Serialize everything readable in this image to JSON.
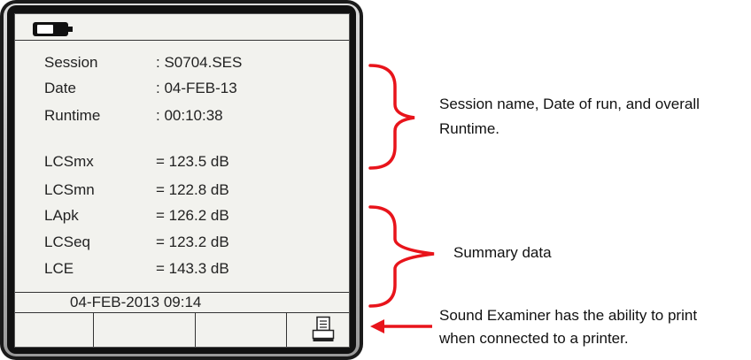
{
  "screen": {
    "status_bar": {
      "battery_icon": "battery-icon"
    },
    "rows": [
      {
        "label": "Session",
        "value": ": S0704.SES"
      },
      {
        "label": "Date",
        "value": ": 04-FEB-13"
      },
      {
        "label": "Runtime",
        "value": ": 00:10:38"
      },
      {
        "label": "LCSmx",
        "value": "= 123.5 dB"
      },
      {
        "label": "LCSmn",
        "value": "= 122.8 dB"
      },
      {
        "label": "LApk",
        "value": "= 126.2 dB"
      },
      {
        "label": "LCSeq",
        "value": "= 123.2 dB"
      },
      {
        "label": "LCE",
        "value": "= 143.3 dB"
      }
    ],
    "datetime": "04-FEB-2013   09:14",
    "softkeys": [
      {
        "label": ""
      },
      {
        "label": ""
      },
      {
        "label": ""
      },
      {
        "label": "",
        "icon": "printer-icon"
      }
    ]
  },
  "annotations": {
    "session_note_line1": "Session name, Date of run, and overall",
    "session_note_line2": "Runtime.",
    "summary_note": "Summary data",
    "print_note_line1": "Sound Examiner has the ability to print",
    "print_note_line2": "when connected to a printer.",
    "accent_color": "#e8141b"
  }
}
